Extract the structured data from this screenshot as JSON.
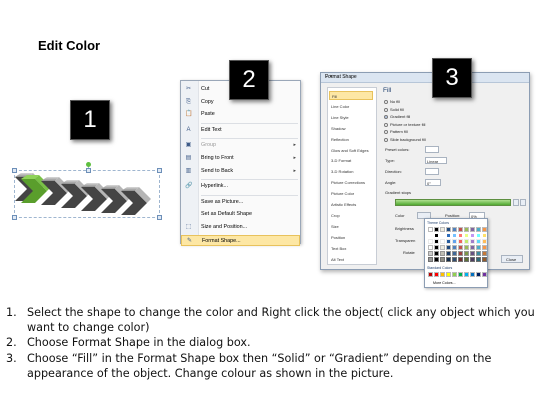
{
  "title": "Edit Color",
  "badges": [
    "1",
    "2",
    "3"
  ],
  "context_menu": {
    "items": [
      {
        "label": "Cut",
        "icon": "scissors-icon",
        "glyph": "✂",
        "disabled": false,
        "submenu": false
      },
      {
        "label": "Copy",
        "icon": "copy-icon",
        "glyph": "⎘",
        "disabled": false,
        "submenu": false
      },
      {
        "label": "Paste",
        "icon": "paste-icon",
        "glyph": "📋",
        "disabled": false,
        "submenu": false
      },
      {
        "label": "Edit Text",
        "icon": "edit-text-icon",
        "glyph": "A",
        "disabled": false,
        "submenu": false,
        "sep_before": true
      },
      {
        "label": "Group",
        "icon": "group-icon",
        "glyph": "▣",
        "disabled": true,
        "submenu": true,
        "sep_before": true
      },
      {
        "label": "Bring to Front",
        "icon": "bring-front-icon",
        "glyph": "▤",
        "disabled": false,
        "submenu": true
      },
      {
        "label": "Send to Back",
        "icon": "send-back-icon",
        "glyph": "▥",
        "disabled": false,
        "submenu": true
      },
      {
        "label": "Hyperlink...",
        "icon": "hyperlink-icon",
        "glyph": "🔗",
        "disabled": false,
        "submenu": false,
        "sep_before": true
      },
      {
        "label": "Save as Picture...",
        "icon": "",
        "glyph": "",
        "disabled": false,
        "submenu": false,
        "sep_before": true
      },
      {
        "label": "Set as Default Shape",
        "icon": "",
        "glyph": "",
        "disabled": false,
        "submenu": false
      },
      {
        "label": "Size and Position...",
        "icon": "size-icon",
        "glyph": "⬚",
        "disabled": false,
        "submenu": false
      },
      {
        "label": "Format Shape...",
        "icon": "format-shape-icon",
        "glyph": "✎",
        "disabled": false,
        "submenu": false,
        "highlighted": true
      }
    ]
  },
  "dialog": {
    "title": "Format Shape",
    "buttons": "? ✕",
    "categories": [
      "Fill",
      "Line Color",
      "Line Style",
      "Shadow",
      "Reflection",
      "Glow and Soft Edges",
      "3-D Format",
      "3-D Rotation",
      "Picture Corrections",
      "Picture Color",
      "Artistic Effects",
      "Crop",
      "Size",
      "Position",
      "Text Box",
      "Alt Text"
    ],
    "selected_category": "Fill",
    "heading": "Fill",
    "fill_options": [
      "No fill",
      "Solid fill",
      "Gradient fill",
      "Picture or texture fill",
      "Pattern fill",
      "Slide background fill"
    ],
    "selected_fill": "Gradient fill",
    "fields": {
      "preset": "Preset colors:",
      "type": "Type:",
      "type_value": "Linear",
      "direction": "Direction:",
      "angle": "Angle:",
      "angle_value": "0°",
      "stops": "Gradient stops",
      "color": "Color",
      "position": "Position:",
      "position_value": "0%",
      "brightness": "Brightness",
      "transparency": "Transparen",
      "rotate": "Rotate",
      "close": "Close"
    }
  },
  "palette": {
    "theme_label": "Theme Colors",
    "standard_label": "Standard Colors",
    "more": "More Colors...",
    "theme_colors": [
      "#ffffff",
      "#000000",
      "#eeece1",
      "#1f497d",
      "#4f81bd",
      "#c0504d",
      "#9bbb59",
      "#8064a2",
      "#4bacc6",
      "#f79646"
    ],
    "standard_colors": [
      "#c00000",
      "#ff0000",
      "#ffc000",
      "#ffff00",
      "#92d050",
      "#00b050",
      "#00b0f0",
      "#0070c0",
      "#002060",
      "#7030a0"
    ]
  },
  "steps": [
    {
      "num": "1.",
      "text": "Select the shape to change the color and Right click the object( click any object which you want to change color)"
    },
    {
      "num": "2.",
      "text": "Choose Format Shape in the dialog box."
    },
    {
      "num": "3.",
      "text": "Choose “Fill” in the Format Shape box then “Solid” or “Gradient” depending on the appearance of the object. Change colour as shown in the picture."
    }
  ]
}
